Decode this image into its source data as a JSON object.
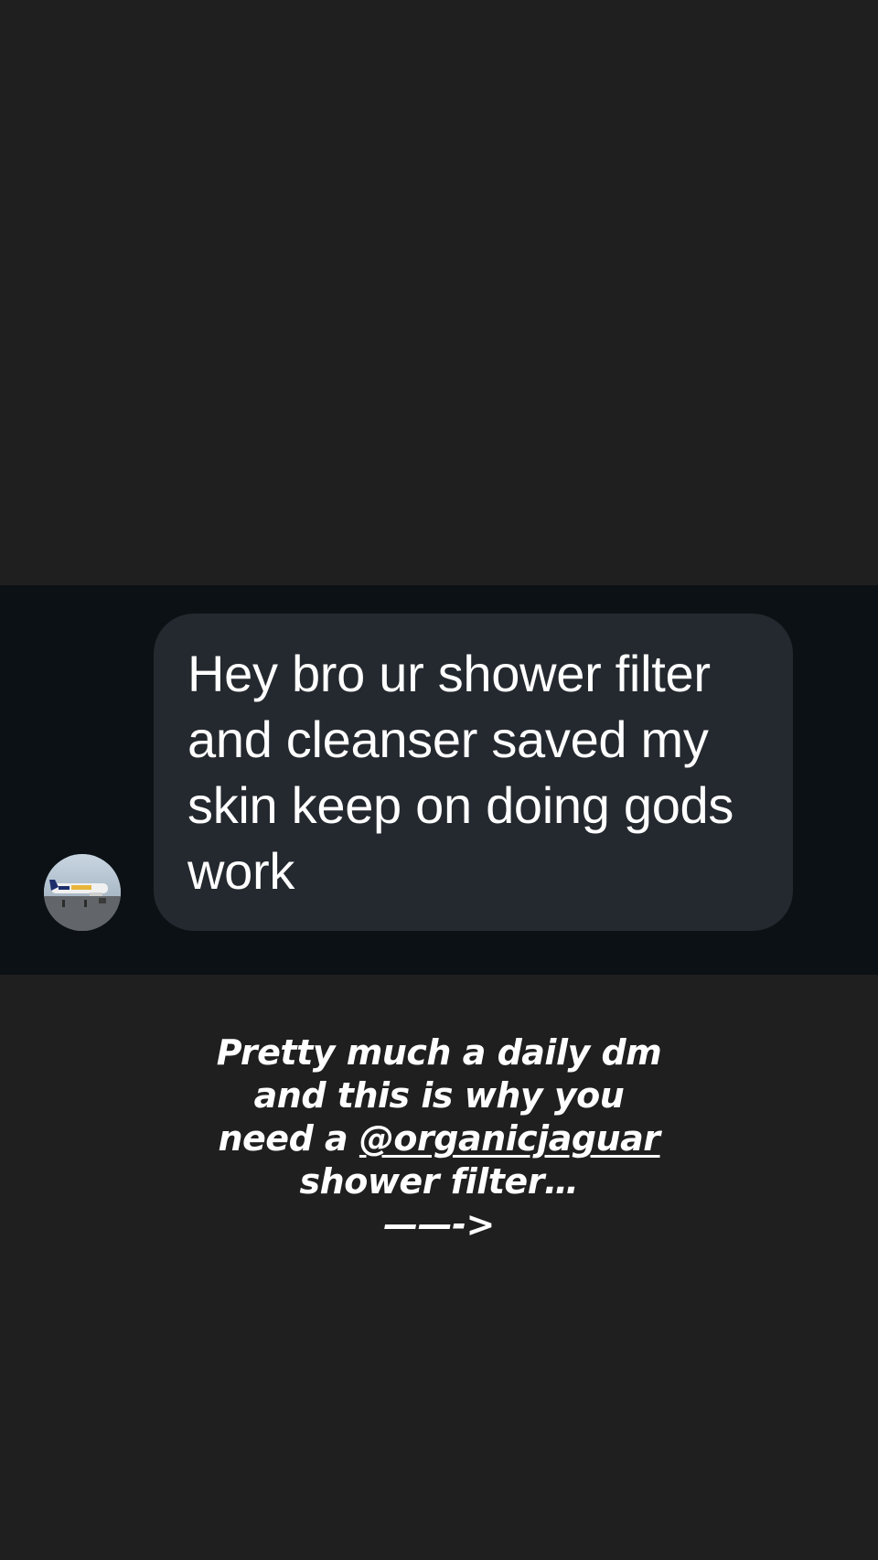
{
  "dm": {
    "message": "Hey bro ur shower filter and cleanser saved my skin keep on doing gods work"
  },
  "caption": {
    "line1": "Pretty much a daily dm",
    "line2": "and this is why you",
    "line3_prefix": "need a ",
    "mention": "@organicjaguar",
    "line4": "shower filter…",
    "arrow": "——->"
  },
  "colors": {
    "background": "#1f1f1f",
    "dm_strip": "#0c1115",
    "bubble": "#24292f",
    "text": "#ffffff"
  }
}
